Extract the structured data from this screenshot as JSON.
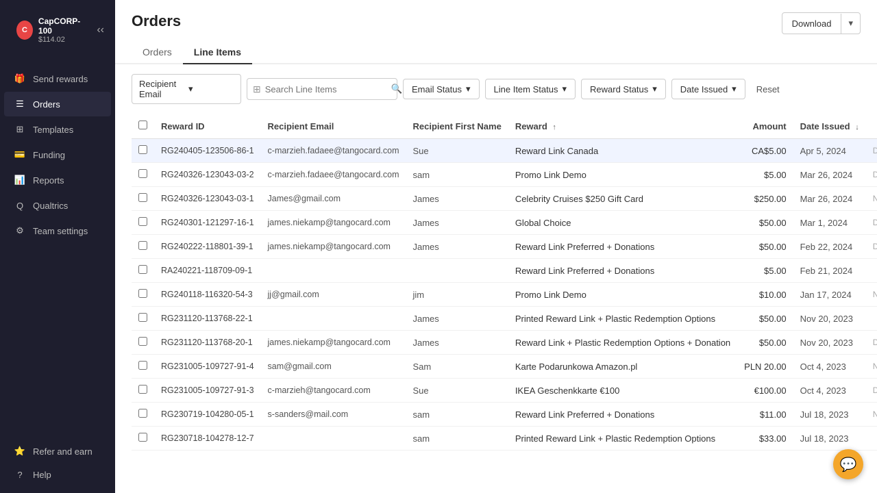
{
  "sidebar": {
    "account": {
      "initials": "C",
      "name": "CapCORP-100",
      "balance": "$114.02"
    },
    "collapse_title": "Collapse",
    "nav_items": [
      {
        "id": "send-rewards",
        "label": "Send rewards",
        "icon": "gift"
      },
      {
        "id": "orders",
        "label": "Orders",
        "icon": "list",
        "active": true
      },
      {
        "id": "templates",
        "label": "Templates",
        "icon": "template"
      },
      {
        "id": "funding",
        "label": "Funding",
        "icon": "credit-card"
      },
      {
        "id": "reports",
        "label": "Reports",
        "icon": "chart"
      },
      {
        "id": "qualtrics",
        "label": "Qualtrics",
        "icon": "q"
      },
      {
        "id": "team-settings",
        "label": "Team settings",
        "icon": "settings"
      }
    ],
    "footer_items": [
      {
        "id": "refer-earn",
        "label": "Refer and earn",
        "icon": "star"
      },
      {
        "id": "help",
        "label": "Help",
        "icon": "help"
      }
    ]
  },
  "header": {
    "title": "Orders",
    "download_label": "Download",
    "download_arrow": "▾"
  },
  "tabs": [
    {
      "id": "orders",
      "label": "Orders"
    },
    {
      "id": "line-items",
      "label": "Line Items",
      "active": true
    }
  ],
  "toolbar": {
    "recipient_select_value": "Recipient Email",
    "search_placeholder": "Search Line Items",
    "filters": [
      {
        "id": "email-status",
        "label": "Email Status"
      },
      {
        "id": "line-item-status",
        "label": "Line Item Status"
      },
      {
        "id": "reward-status",
        "label": "Reward Status"
      },
      {
        "id": "date-issued",
        "label": "Date Issued"
      }
    ],
    "reset_label": "Reset"
  },
  "table": {
    "columns": [
      {
        "id": "reward-id",
        "label": "Reward ID",
        "sortable": false
      },
      {
        "id": "recipient-email",
        "label": "Recipient Email",
        "sortable": false
      },
      {
        "id": "recipient-first-name",
        "label": "Recipient First Name",
        "sortable": false
      },
      {
        "id": "reward",
        "label": "Reward",
        "sortable": true,
        "sort_direction": "asc"
      },
      {
        "id": "amount",
        "label": "Amount",
        "sortable": false
      },
      {
        "id": "date-issued",
        "label": "Date Issued",
        "sortable": true,
        "sort_direction": "desc"
      },
      {
        "id": "status",
        "label": "",
        "sortable": false
      }
    ],
    "rows": [
      {
        "reward_id": "RG240405-123506-86-1",
        "email": "c-marzieh.fadaee@tangocard.com",
        "first_name": "Sue",
        "reward": "Reward Link Canada",
        "amount": "CA$5.00",
        "date": "Apr 5, 2024",
        "status": "Del",
        "highlighted": true
      },
      {
        "reward_id": "RG240326-123043-03-2",
        "email": "c-marzieh.fadaee@tangocard.com",
        "first_name": "sam",
        "reward": "Promo Link Demo",
        "amount": "$5.00",
        "date": "Mar 26, 2024",
        "status": "Del",
        "highlighted": false
      },
      {
        "reward_id": "RG240326-123043-03-1",
        "email": "James@gmail.com",
        "first_name": "James",
        "reward": "Celebrity Cruises $250 Gift Card",
        "amount": "$250.00",
        "date": "Mar 26, 2024",
        "status": "Not",
        "highlighted": false
      },
      {
        "reward_id": "RG240301-121297-16-1",
        "email": "james.niekamp@tangocard.com",
        "first_name": "James",
        "reward": "Global Choice",
        "amount": "$50.00",
        "date": "Mar 1, 2024",
        "status": "Del",
        "highlighted": false
      },
      {
        "reward_id": "RG240222-118801-39-1",
        "email": "james.niekamp@tangocard.com",
        "first_name": "James",
        "reward": "Reward Link Preferred + Donations",
        "amount": "$50.00",
        "date": "Feb 22, 2024",
        "status": "Del",
        "highlighted": false
      },
      {
        "reward_id": "RA240221-118709-09-1",
        "email": "",
        "first_name": "",
        "reward": "Reward Link Preferred + Donations",
        "amount": "$5.00",
        "date": "Feb 21, 2024",
        "status": "",
        "highlighted": false
      },
      {
        "reward_id": "RG240118-116320-54-3",
        "email": "jj@gmail.com",
        "first_name": "jim",
        "reward": "Promo Link Demo",
        "amount": "$10.00",
        "date": "Jan 17, 2024",
        "status": "Not",
        "highlighted": false
      },
      {
        "reward_id": "RG231120-113768-22-1",
        "email": "",
        "first_name": "James",
        "reward": "Printed Reward Link + Plastic Redemption Options",
        "amount": "$50.00",
        "date": "Nov 20, 2023",
        "status": "",
        "highlighted": false
      },
      {
        "reward_id": "RG231120-113768-20-1",
        "email": "james.niekamp@tangocard.com",
        "first_name": "James",
        "reward": "Reward Link + Plastic Redemption Options + Donation",
        "amount": "$50.00",
        "date": "Nov 20, 2023",
        "status": "Del",
        "highlighted": false
      },
      {
        "reward_id": "RG231005-109727-91-4",
        "email": "sam@gmail.com",
        "first_name": "Sam",
        "reward": "Karte Podarunkowa Amazon.pl",
        "amount": "PLN 20.00",
        "date": "Oct 4, 2023",
        "status": "Not",
        "highlighted": false
      },
      {
        "reward_id": "RG231005-109727-91-3",
        "email": "c-marzieh@tangocard.com",
        "first_name": "Sue",
        "reward": "IKEA Geschenkkarte €100",
        "amount": "€100.00",
        "date": "Oct 4, 2023",
        "status": "Del",
        "highlighted": false
      },
      {
        "reward_id": "RG230719-104280-05-1",
        "email": "s-sanders@mail.com",
        "first_name": "sam",
        "reward": "Reward Link Preferred + Donations",
        "amount": "$11.00",
        "date": "Jul 18, 2023",
        "status": "Not",
        "highlighted": false
      },
      {
        "reward_id": "RG230718-104278-12-7",
        "email": "",
        "first_name": "sam",
        "reward": "Printed Reward Link + Plastic Redemption Options",
        "amount": "$33.00",
        "date": "Jul 18, 2023",
        "status": "",
        "highlighted": false
      }
    ]
  },
  "chat_btn": "💬"
}
